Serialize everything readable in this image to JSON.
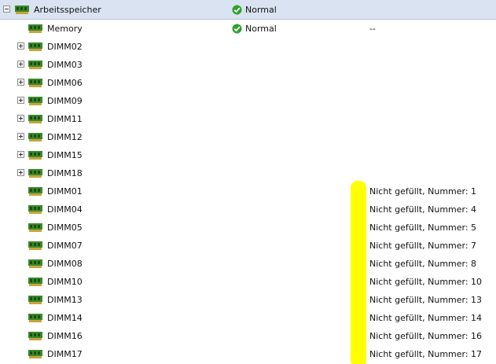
{
  "header": {
    "label": "Arbeitsspeicher",
    "status": "Normal",
    "icon": "memory-chip-icon",
    "status_icon": "check-circle-icon",
    "expanded": true
  },
  "memory_row": {
    "label": "Memory",
    "status": "Normal",
    "detail": "--"
  },
  "expandable_dimms": [
    {
      "label": "DIMM02"
    },
    {
      "label": "DIMM03"
    },
    {
      "label": "DIMM06"
    },
    {
      "label": "DIMM09"
    },
    {
      "label": "DIMM11"
    },
    {
      "label": "DIMM12"
    },
    {
      "label": "DIMM15"
    },
    {
      "label": "DIMM18"
    }
  ],
  "empty_dimms": [
    {
      "label": "DIMM01",
      "detail": "Nicht gefüllt, Nummer: 1"
    },
    {
      "label": "DIMM04",
      "detail": "Nicht gefüllt, Nummer: 4"
    },
    {
      "label": "DIMM05",
      "detail": "Nicht gefüllt, Nummer: 5"
    },
    {
      "label": "DIMM07",
      "detail": "Nicht gefüllt, Nummer: 7"
    },
    {
      "label": "DIMM08",
      "detail": "Nicht gefüllt, Nummer: 8"
    },
    {
      "label": "DIMM10",
      "detail": "Nicht gefüllt, Nummer: 10"
    },
    {
      "label": "DIMM13",
      "detail": "Nicht gefüllt, Nummer: 13"
    },
    {
      "label": "DIMM14",
      "detail": "Nicht gefüllt, Nummer: 14"
    },
    {
      "label": "DIMM16",
      "detail": "Nicht gefüllt, Nummer: 16"
    },
    {
      "label": "DIMM17",
      "detail": "Nicht gefüllt, Nummer: 17"
    }
  ],
  "colors": {
    "header_bg": "#d9e3f1",
    "chip_green": "#3a8a2a",
    "status_green": "#2fa12f",
    "highlight": "#ffff00"
  }
}
